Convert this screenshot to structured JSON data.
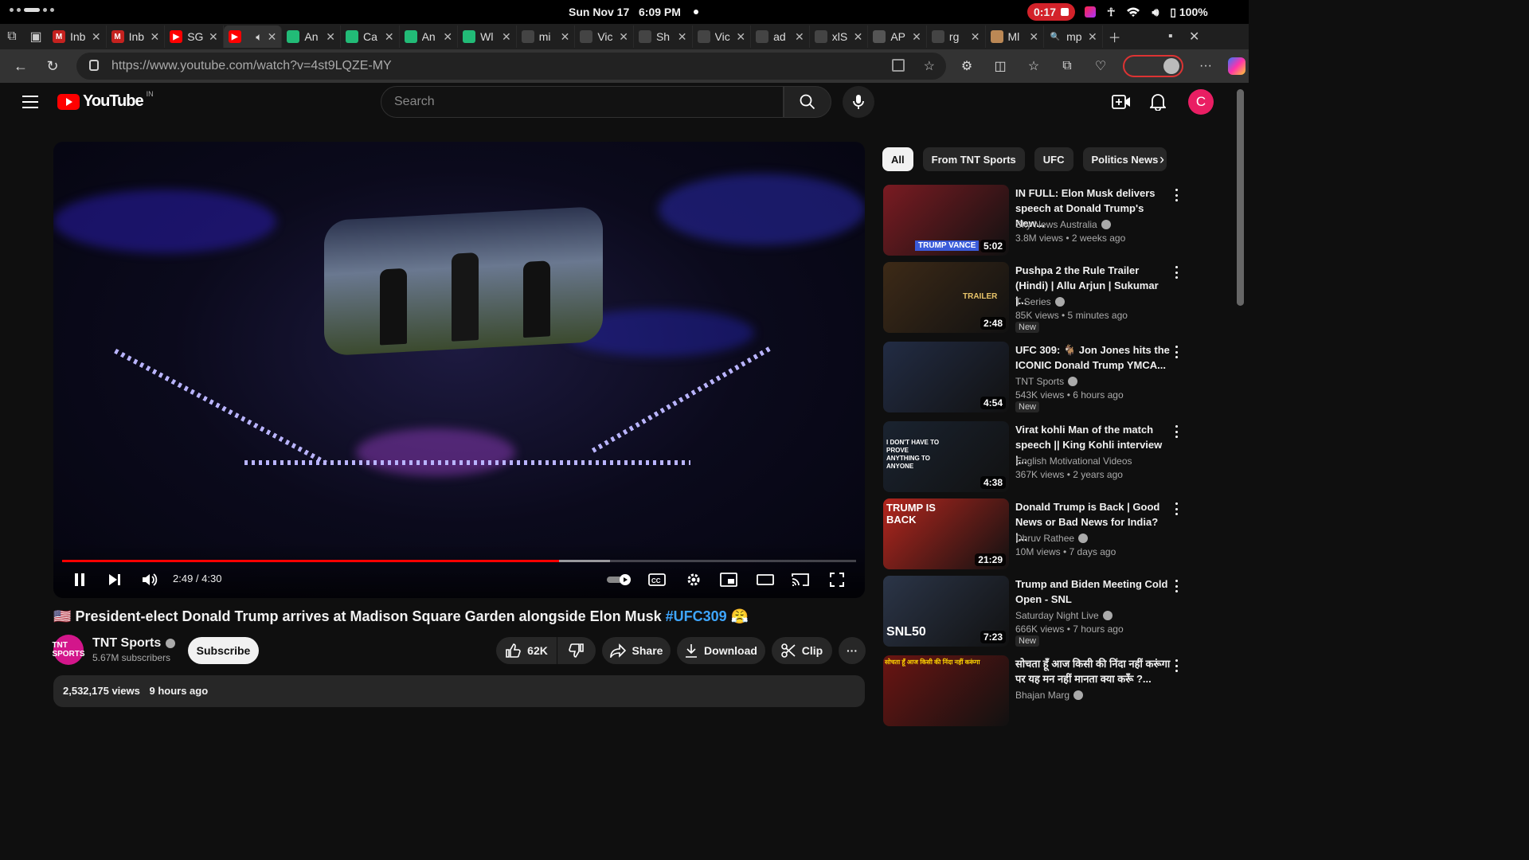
{
  "system": {
    "date": "Sun Nov 17",
    "time": "6:09 PM",
    "recording": "0:17",
    "battery": "100%"
  },
  "tabs": [
    {
      "label": "Inb",
      "fav": "M",
      "color": "#c5221f"
    },
    {
      "label": "Inb",
      "fav": "M",
      "color": "#c5221f"
    },
    {
      "label": "SG",
      "fav": "▶",
      "color": "#f00"
    },
    {
      "label": "",
      "fav": "▶",
      "color": "#f00"
    },
    {
      "label": "An",
      "fav": "",
      "color": "#2b7"
    },
    {
      "label": "Ca",
      "fav": "",
      "color": "#2b7"
    },
    {
      "label": "An",
      "fav": "",
      "color": "#2b7"
    },
    {
      "label": "Wl",
      "fav": "",
      "color": "#2b7"
    },
    {
      "label": "mi",
      "fav": "",
      "color": "#444"
    },
    {
      "label": "Vic",
      "fav": "",
      "color": "#444"
    },
    {
      "label": "Sh",
      "fav": "",
      "color": "#444"
    },
    {
      "label": "Vic",
      "fav": "",
      "color": "#444"
    },
    {
      "label": "ad",
      "fav": "",
      "color": "#444"
    },
    {
      "label": "xlS",
      "fav": "",
      "color": "#444"
    },
    {
      "label": "AP",
      "fav": "",
      "color": "#555"
    },
    {
      "label": "rg",
      "fav": "",
      "color": "#444"
    },
    {
      "label": "Ml",
      "fav": "",
      "color": "#b85"
    },
    {
      "label": "mp",
      "fav": "🔍",
      "color": "#1f1f1f"
    }
  ],
  "browser": {
    "url": "https://www.youtube.com/watch?v=4st9LQZE-MY"
  },
  "youtube": {
    "logo_text": "YouTube",
    "country": "IN",
    "search_placeholder": "Search",
    "avatar_letter": "C"
  },
  "player": {
    "time": "2:49 / 4:30",
    "progress": 0.626,
    "buffered": 0.69
  },
  "video": {
    "flag": "🇺🇸",
    "title": "President-elect Donald Trump arrives at Madison Square Garden alongside Elon Musk",
    "hashtag": "#UFC309",
    "emoji": "😤",
    "channel": "TNT Sports",
    "channel_logo": "TNT SPORTS",
    "subscribers": "5.67M subscribers",
    "subscribe_label": "Subscribe",
    "likes": "62K",
    "share_label": "Share",
    "download_label": "Download",
    "clip_label": "Clip",
    "views": "2,532,175 views",
    "age": "9 hours ago"
  },
  "chips": [
    "All",
    "From TNT Sports",
    "UFC",
    "Politics News"
  ],
  "recommendations": [
    {
      "title_1": "IN FULL: Elon Musk delivers",
      "title_2": "speech at Donald Trump's New...",
      "channel": "Sky News Australia",
      "meta": "3.8M views • 2 weeks ago",
      "duration": "5:02",
      "new": "",
      "bg": "#7a1b22"
    },
    {
      "title_1": "Pushpa 2 the Rule Trailer",
      "title_2": "(Hindi) | Allu Arjun | Sukumar |...",
      "channel": "T-Series",
      "meta": "85K views • 5 minutes ago",
      "duration": "2:48",
      "new": "New",
      "bg": "#3d2a17"
    },
    {
      "title_1": "UFC 309: 🐐 Jon Jones hits the",
      "title_2": "ICONIC Donald Trump YMCA...",
      "channel": "TNT Sports",
      "meta": "543K views • 6 hours ago",
      "duration": "4:54",
      "new": "New",
      "bg": "#222c44"
    },
    {
      "title_1": "Virat kohli Man of the match",
      "title_2": "speech || King Kohli interview |...",
      "channel": "English Motivational Videos",
      "meta": "367K views • 2 years ago",
      "duration": "4:38",
      "new": "",
      "bg": "#1a2330"
    },
    {
      "title_1": "Donald Trump is Back | Good",
      "title_2": "News or Bad News for India? |...",
      "channel": "Dhruv Rathee",
      "meta": "10M views • 7 days ago",
      "duration": "21:29",
      "new": "",
      "bg": "#b3261e"
    },
    {
      "title_1": "Trump and Biden Meeting Cold",
      "title_2": "Open - SNL",
      "channel": "Saturday Night Live",
      "meta": "666K views • 7 hours ago",
      "duration": "7:23",
      "new": "New",
      "bg": "#2b3548"
    },
    {
      "title_1": "सोचता हूँ आज किसी की निंदा नहीं करूंगा",
      "title_2": "पर यह मन नहीं मानता क्या करूँ ?...",
      "channel": "Bhajan Marg",
      "meta": "",
      "duration": "",
      "new": "",
      "bg": "#6b1512"
    }
  ],
  "thumb_text": {
    "trump_vance": "TRUMP VANCE",
    "pushpa": "TRAILER",
    "virat": "I DON'T HAVE TO PROVE ANYTHING TO ANYONE",
    "dhruv": "TRUMP IS BACK",
    "snl": "SNL50",
    "bhajan": "सोचता हूँ आज किसी की निंदा नहीं करूंगा"
  },
  "colors": {
    "accent_red": "#ff0000",
    "link_blue": "#3ea6ff",
    "background": "#0f0f0f"
  }
}
